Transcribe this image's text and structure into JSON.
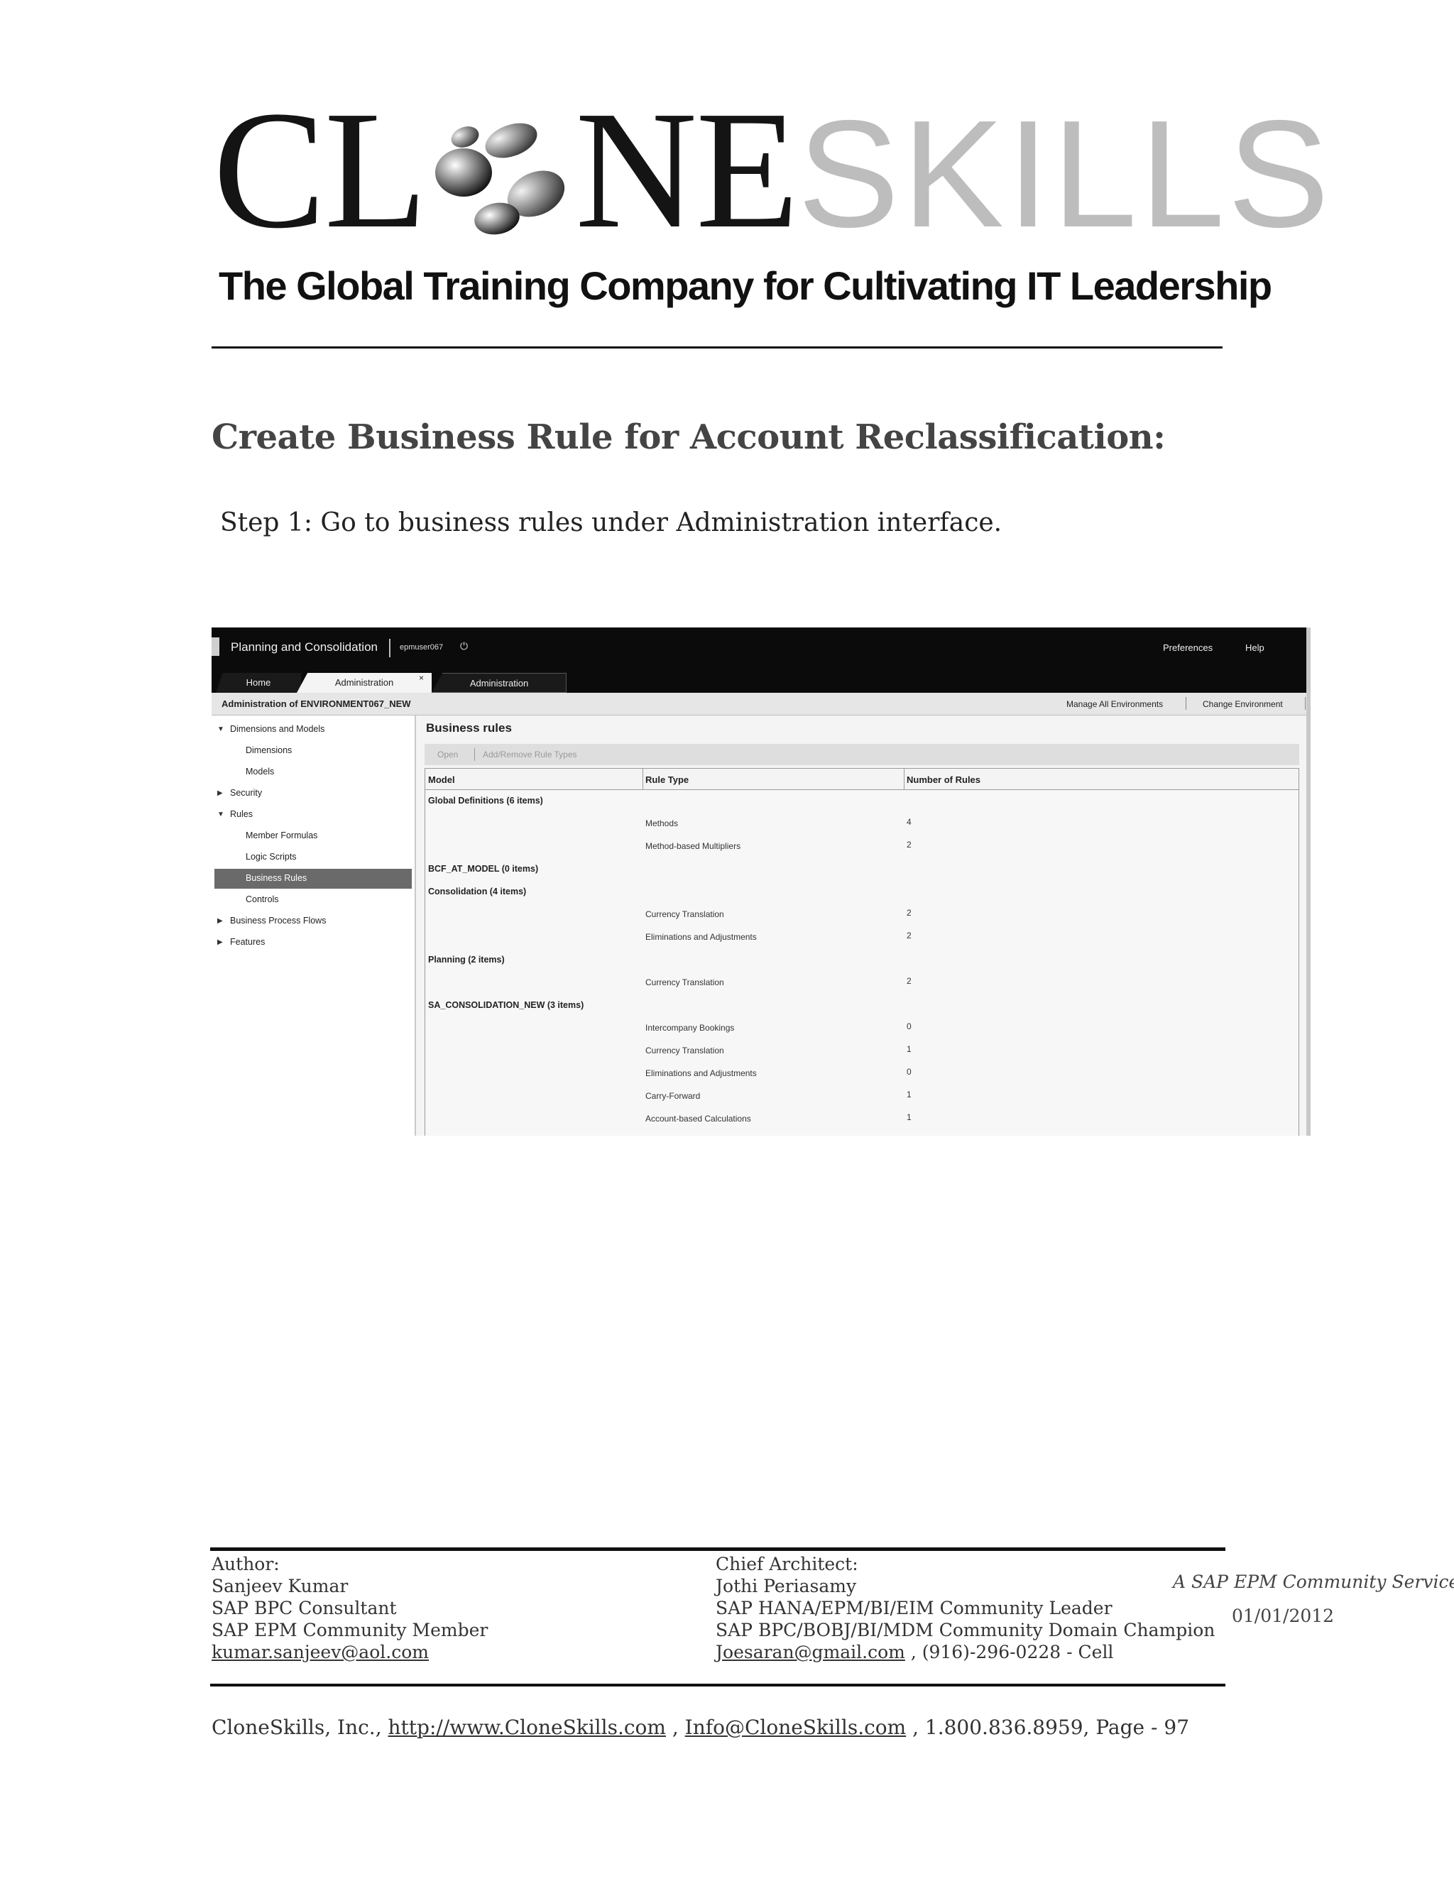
{
  "logo": {
    "word_dark_1": "CL",
    "word_dark_2": "NE",
    "word_light": "SKILLS"
  },
  "tagline": "The Global Training Company for Cultivating IT Leadership",
  "title": "Create Business Rule for Account Reclassification:",
  "step": "Step 1:  Go to business rules under Administration interface.",
  "screenshot": {
    "app_title": "Planning and Consolidation",
    "user": "epmuser067",
    "preferences": "Preferences",
    "help": "Help",
    "tabs": [
      "Home",
      "Administration",
      "Administration"
    ],
    "tab_close": "×",
    "admin_title": "Administration of ENVIRONMENT067_NEW",
    "manage_envs": "Manage All Environments",
    "change_env": "Change Environment",
    "nav": {
      "dimensions_and_models": "Dimensions and Models",
      "dimensions": "Dimensions",
      "models": "Models",
      "security": "Security",
      "rules": "Rules",
      "member_formulas": "Member Formulas",
      "logic_scripts": "Logic Scripts",
      "business_rules": "Business Rules",
      "controls": "Controls",
      "business_process_flows": "Business Process Flows",
      "features": "Features"
    },
    "main_title": "Business rules",
    "toolbar": {
      "open": "Open",
      "add_remove": "Add/Remove Rule Types"
    },
    "columns": [
      "Model",
      "Rule Type",
      "Number of Rules"
    ],
    "groups": [
      "Global Definitions (6 items)",
      "BCF_AT_MODEL (0 items)",
      "Consolidation (4 items)",
      "Planning (2 items)",
      "SA_CONSOLIDATION_NEW (3 items)"
    ],
    "rows": [
      {
        "type": "Methods",
        "count": "4"
      },
      {
        "type": "Method-based Multipliers",
        "count": "2"
      },
      {
        "type": "Currency Translation",
        "count": "2"
      },
      {
        "type": "Eliminations and Adjustments",
        "count": "2"
      },
      {
        "type": "Currency Translation",
        "count": "2"
      },
      {
        "type": "Intercompany Bookings",
        "count": "0"
      },
      {
        "type": "Currency Translation",
        "count": "1"
      },
      {
        "type": "Eliminations and Adjustments",
        "count": "0"
      },
      {
        "type": "Carry-Forward",
        "count": "1"
      },
      {
        "type": "Account-based Calculations",
        "count": "1"
      }
    ]
  },
  "footer": {
    "author_label": "Author:",
    "author_name": "Sanjeev Kumar",
    "author_role1": "SAP BPC Consultant",
    "author_role2": "SAP EPM Community Member",
    "author_email": "kumar.sanjeev@aol.com",
    "chief_label": "Chief Architect:",
    "chief_name": "Jothi Periasamy",
    "chief_role1": "SAP HANA/EPM/BI/EIM Community Leader",
    "chief_role2": "SAP BPC/BOBJ/BI/MDM Community Domain Champion",
    "chief_email": "Joesaran@gmail.com",
    "chief_phone": " , (916)-296-0228 - Cell",
    "service": "A SAP EPM Community Service",
    "date": "01/01/2012",
    "company": "CloneSkills, Inc., ",
    "website": "http://www.CloneSkills.com",
    "sep1": " , ",
    "info_email": "Info@CloneSkills.com",
    "rest": " , 1.800.836.8959, Page - 97"
  }
}
